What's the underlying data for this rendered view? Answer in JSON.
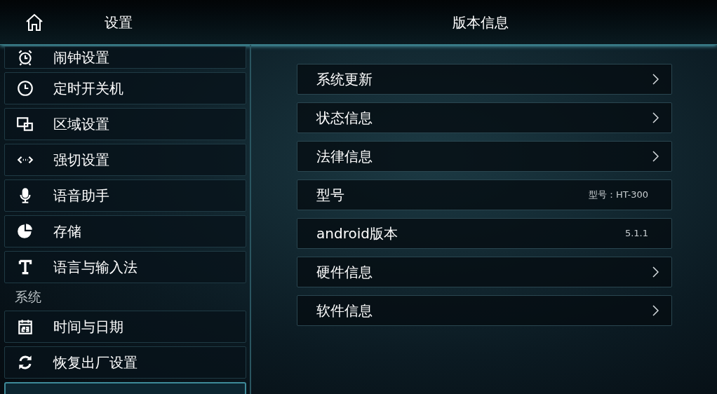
{
  "header": {
    "title": "设置",
    "page_title": "版本信息"
  },
  "sidebar": {
    "items": [
      {
        "kind": "item",
        "label": "闹钟设置"
      },
      {
        "kind": "item",
        "label": "定时开关机"
      },
      {
        "kind": "item",
        "label": "区域设置"
      },
      {
        "kind": "item",
        "label": "强切设置"
      },
      {
        "kind": "item",
        "label": "语音助手"
      },
      {
        "kind": "item",
        "label": "存储"
      },
      {
        "kind": "item",
        "label": "语言与输入法"
      },
      {
        "kind": "section",
        "label": "系统"
      },
      {
        "kind": "item",
        "label": "时间与日期"
      },
      {
        "kind": "item",
        "label": "恢复出厂设置"
      }
    ]
  },
  "rows": [
    {
      "kind": "link",
      "label": "系统更新"
    },
    {
      "kind": "link",
      "label": "状态信息"
    },
    {
      "kind": "link",
      "label": "法律信息"
    },
    {
      "kind": "value",
      "label": "型号",
      "value": "型号：HT-300"
    },
    {
      "kind": "value",
      "label": "android版本",
      "value": "5.1.1"
    },
    {
      "kind": "link",
      "label": "硬件信息"
    },
    {
      "kind": "link",
      "label": "软件信息"
    }
  ]
}
